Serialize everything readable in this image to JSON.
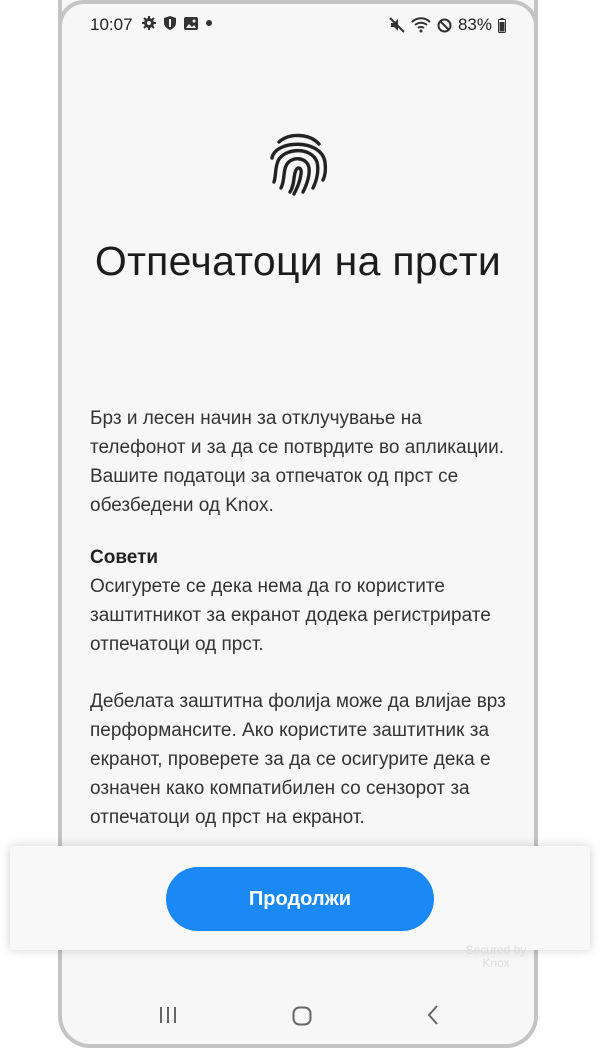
{
  "status_bar": {
    "time": "10:07",
    "battery": "83%",
    "left_icons": [
      "gear-icon",
      "shield-icon",
      "image-icon",
      "dot-icon"
    ],
    "right_icons": [
      "mute-icon",
      "wifi-icon",
      "no-sign-icon",
      "battery-icon"
    ]
  },
  "header": {
    "icon": "fingerprint-icon",
    "title": "Отпечатоци на прсти"
  },
  "body": {
    "intro": "Брз и лесен начин за отклучување на телефонот и за да се потврдите во апликации. Вашите податоци за отпечаток од прст се обезбедени од Knox.",
    "tips_title": "Совети",
    "tip_1": "Осигурете се дека нема да го користите заштитникот за екранот додека регистрирате отпечатоци од прст.",
    "tip_2": "Дебелата заштитна фолија може да влијае врз перформансите. Ако користите заштитник за екранот, проверете за да се осигурите дека е означен како компатибилен со сензорот за отпечатоци од прст на екранот."
  },
  "footer": {
    "continue_label": "Продолжи",
    "watermark_line1": "Secured by",
    "watermark_line2": "Knox"
  },
  "nav": {
    "icons": [
      "recent-apps-icon",
      "home-icon",
      "back-icon"
    ]
  },
  "colors": {
    "accent": "#1a88f5",
    "background": "#f7f7f7"
  }
}
